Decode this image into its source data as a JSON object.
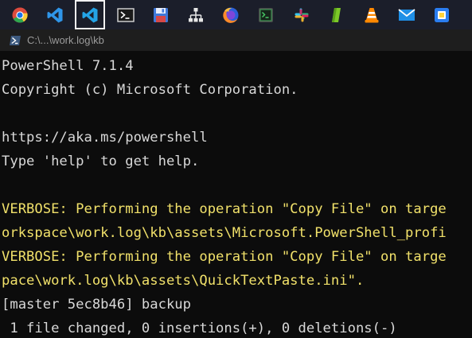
{
  "taskbar": {
    "apps": [
      {
        "name": "chrome-icon"
      },
      {
        "name": "vscode-icon"
      },
      {
        "name": "vscode-insiders-icon",
        "active": true
      },
      {
        "name": "powershell-icon"
      },
      {
        "name": "floppy-save-icon"
      },
      {
        "name": "network-tree-icon"
      },
      {
        "name": "firefox-icon"
      },
      {
        "name": "terminal-app-icon"
      },
      {
        "name": "slack-icon"
      },
      {
        "name": "green-app-icon"
      },
      {
        "name": "vlc-icon"
      },
      {
        "name": "mail-icon"
      },
      {
        "name": "blue-app-icon"
      }
    ]
  },
  "window": {
    "title": "C:\\...\\work.log\\kb"
  },
  "colors": {
    "background": "#0c0c0c",
    "text": "#d8d8d8",
    "verbose": "#f1e16a"
  },
  "terminal": {
    "lines": [
      "PowerShell 7.1.4",
      "Copyright (c) Microsoft Corporation.",
      "",
      "https://aka.ms/powershell",
      "Type 'help' to get help.",
      "",
      "VERBOSE: Performing the operation \"Copy File\" on targe",
      "orkspace\\work.log\\kb\\assets\\Microsoft.PowerShell_profi",
      "VERBOSE: Performing the operation \"Copy File\" on targe",
      "pace\\work.log\\kb\\assets\\QuickTextPaste.ini\".",
      "[master 5ec8b46] backup",
      " 1 file changed, 0 insertions(+), 0 deletions(-)"
    ]
  }
}
